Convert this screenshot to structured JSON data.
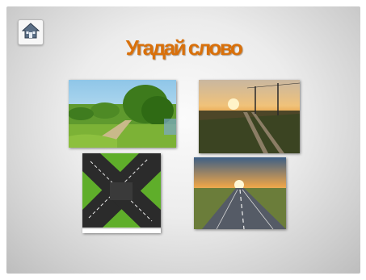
{
  "slide": {
    "title": "Угадай слово",
    "home_icon": "home-icon"
  },
  "pictures": [
    {
      "id": "countryside",
      "description_icon": "landscape-image"
    },
    {
      "id": "railway",
      "description_icon": "railway-sunset-image"
    },
    {
      "id": "crossroads",
      "description_icon": "crossroads-image"
    },
    {
      "id": "highway",
      "description_icon": "highway-sunset-image"
    }
  ],
  "colors": {
    "title": "#d9700a",
    "background": "#e6e6e6"
  }
}
